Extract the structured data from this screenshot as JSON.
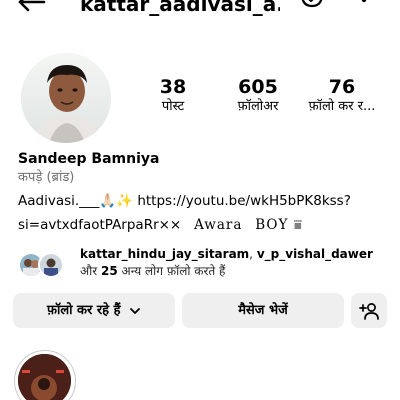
{
  "header": {
    "username": "kattar_aadivasi_a..."
  },
  "profile": {
    "stats": [
      {
        "value": "38",
        "label": "पोस्ट"
      },
      {
        "value": "605",
        "label": "फ़ॉलोअर"
      },
      {
        "value": "76",
        "label": "फ़ॉलो कर र..."
      }
    ],
    "name": "Sandeep Bamniya",
    "category": "कपड़े (ब्रांड)",
    "bio_line1": "Aadivasi.___🙏🏻✨ https://youtu.be/wkH5bPK8kss?",
    "bio_line2_link": "si=avtxdfaotPArpaRr××",
    "bio_line2_awara": "Awara",
    "bio_line2_boy": "BOY ⩸"
  },
  "followed_by": {
    "user1": "kattar_hindu_jay_sitaram",
    "separator": ",",
    "user2": "v_p_vishal_dawer",
    "middle": "और",
    "count": "25",
    "suffix": "अन्य लोग फ़ॉलो करते हैं"
  },
  "buttons": {
    "following": "फ़ॉलो कर रहे हैं",
    "message": "मैसेज भेजें"
  },
  "icons": {
    "back": "back-arrow-icon",
    "threads": "threads-icon",
    "more": "more-vertical-icon",
    "chevron": "chevron-down-icon",
    "add_person": "add-person-icon"
  }
}
